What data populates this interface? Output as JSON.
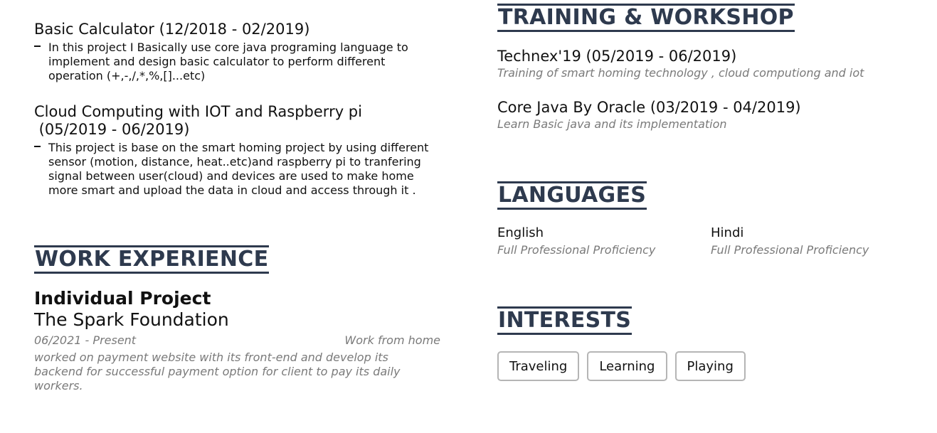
{
  "projects": [
    {
      "title": "Basic Calculator (12/2018 - 02/2019)",
      "bullets": [
        "In this project I Basically use core java programing language to implement and design basic calculator to perform different operation (+,-,/,*,%,[]...etc)"
      ]
    },
    {
      "title_line1": "Cloud Computing with IOT and Raspberry pi",
      "title_line2": " (05/2019 - 06/2019)",
      "bullets": [
        "This project is base on the smart homing project by using different sensor (motion, distance, heat..etc)and raspberry pi to tranfering signal between user(cloud) and devices are used to make home more smart and upload the data in cloud and access through it ."
      ]
    }
  ],
  "work_experience": {
    "heading": "WORK EXPERIENCE",
    "job": {
      "title": "Individual Project",
      "company": "The Spark Foundation",
      "dates": "06/2021 - Present",
      "location": "Work from home",
      "description": "worked on payment website with its front-end and develop its backend for successful payment option for client to pay its daily workers."
    }
  },
  "training": {
    "heading": "TRAINING & WORKSHOP",
    "items": [
      {
        "title": "Technex'19 (05/2019 - 06/2019)",
        "description": "Training of smart homing technology , cloud computiong and iot"
      },
      {
        "title": "Core Java By Oracle (03/2019 - 04/2019)",
        "description": "Learn Basic java and its implementation"
      }
    ]
  },
  "languages": {
    "heading": "LANGUAGES",
    "items": [
      {
        "name": "English",
        "level": "Full Professional Proficiency"
      },
      {
        "name": "Hindi",
        "level": "Full Professional Proficiency"
      }
    ]
  },
  "interests": {
    "heading": "INTERESTS",
    "items": [
      "Traveling",
      "Learning",
      "Playing"
    ]
  },
  "colors": {
    "heading": "#2e3a4e",
    "muted": "#7a7a7a",
    "chip_border": "#b5b5b5"
  }
}
